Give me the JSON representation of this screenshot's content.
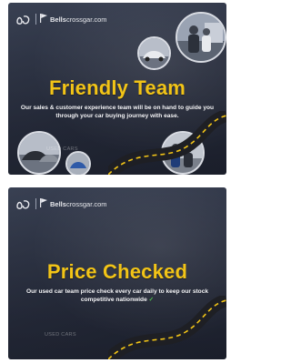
{
  "cards": [
    {
      "logo": {
        "brand_bold": "Bells",
        "brand_rest": "crossgar.com"
      },
      "headline": "Friendly Team",
      "body": "Our sales & customer experience team will be on hand to guide you through your car buying journey with ease.",
      "watermark": "USED CARS"
    },
    {
      "logo": {
        "brand_bold": "Bells",
        "brand_rest": "crossgar.com"
      },
      "headline": "Price Checked",
      "body": "Our used car team price check every car daily to keep our stock competitive nationwide",
      "check_glyph": "✓",
      "watermark": "USED CARS"
    }
  ],
  "colors": {
    "headline": "#f2c417",
    "background": "#2b3143",
    "road": "#1e1f24",
    "road_dashes": "#f2c417",
    "check": "#4fc24f"
  }
}
